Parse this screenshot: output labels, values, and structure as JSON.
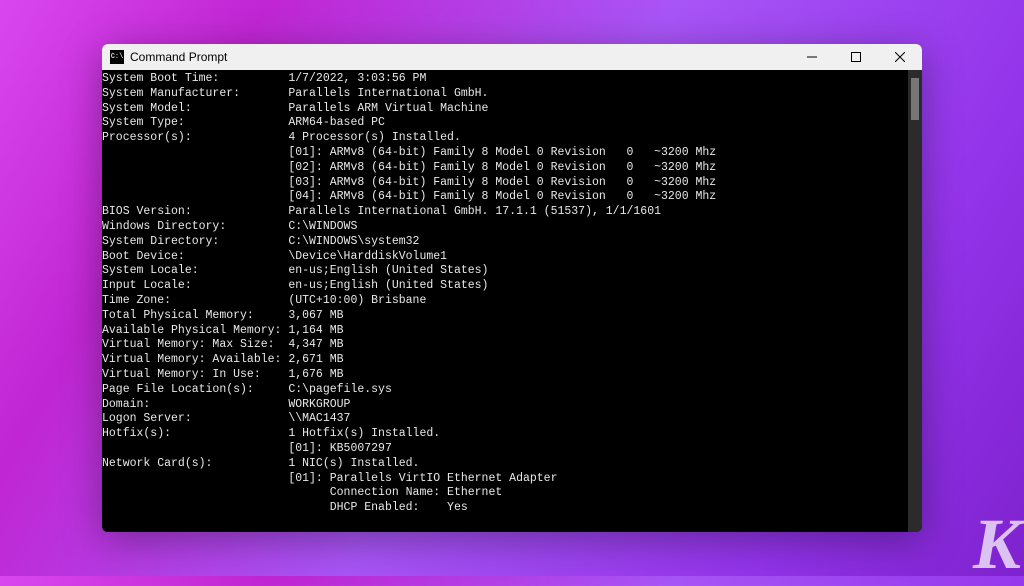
{
  "window": {
    "title": "Command Prompt",
    "icon_glyph": "C:\\"
  },
  "sysinfo": {
    "label_width": 27,
    "indent": 27,
    "rows": [
      {
        "label": "System Boot Time:",
        "value": "1/7/2022, 3:03:56 PM"
      },
      {
        "label": "System Manufacturer:",
        "value": "Parallels International GmbH."
      },
      {
        "label": "System Model:",
        "value": "Parallels ARM Virtual Machine"
      },
      {
        "label": "System Type:",
        "value": "ARM64-based PC"
      },
      {
        "label": "Processor(s):",
        "value": "4 Processor(s) Installed."
      },
      {
        "label": "",
        "value": "[01]: ARMv8 (64-bit) Family 8 Model 0 Revision   0   ~3200 Mhz"
      },
      {
        "label": "",
        "value": "[02]: ARMv8 (64-bit) Family 8 Model 0 Revision   0   ~3200 Mhz"
      },
      {
        "label": "",
        "value": "[03]: ARMv8 (64-bit) Family 8 Model 0 Revision   0   ~3200 Mhz"
      },
      {
        "label": "",
        "value": "[04]: ARMv8 (64-bit) Family 8 Model 0 Revision   0   ~3200 Mhz"
      },
      {
        "label": "BIOS Version:",
        "value": "Parallels International GmbH. 17.1.1 (51537), 1/1/1601"
      },
      {
        "label": "Windows Directory:",
        "value": "C:\\WINDOWS"
      },
      {
        "label": "System Directory:",
        "value": "C:\\WINDOWS\\system32"
      },
      {
        "label": "Boot Device:",
        "value": "\\Device\\HarddiskVolume1"
      },
      {
        "label": "System Locale:",
        "value": "en-us;English (United States)"
      },
      {
        "label": "Input Locale:",
        "value": "en-us;English (United States)"
      },
      {
        "label": "Time Zone:",
        "value": "(UTC+10:00) Brisbane"
      },
      {
        "label": "Total Physical Memory:",
        "value": "3,067 MB"
      },
      {
        "label": "Available Physical Memory:",
        "value": "1,164 MB"
      },
      {
        "label": "Virtual Memory: Max Size:",
        "value": "4,347 MB"
      },
      {
        "label": "Virtual Memory: Available:",
        "value": "2,671 MB"
      },
      {
        "label": "Virtual Memory: In Use:",
        "value": "1,676 MB"
      },
      {
        "label": "Page File Location(s):",
        "value": "C:\\pagefile.sys"
      },
      {
        "label": "Domain:",
        "value": "WORKGROUP"
      },
      {
        "label": "Logon Server:",
        "value": "\\\\MAC1437"
      },
      {
        "label": "Hotfix(s):",
        "value": "1 Hotfix(s) Installed."
      },
      {
        "label": "",
        "value": "[01]: KB5007297"
      },
      {
        "label": "Network Card(s):",
        "value": "1 NIC(s) Installed."
      },
      {
        "label": "",
        "value": "[01]: Parallels VirtIO Ethernet Adapter"
      },
      {
        "label": "",
        "value": "      Connection Name: Ethernet"
      },
      {
        "label": "",
        "value": "      DHCP Enabled:    Yes"
      }
    ]
  },
  "watermark": "K"
}
